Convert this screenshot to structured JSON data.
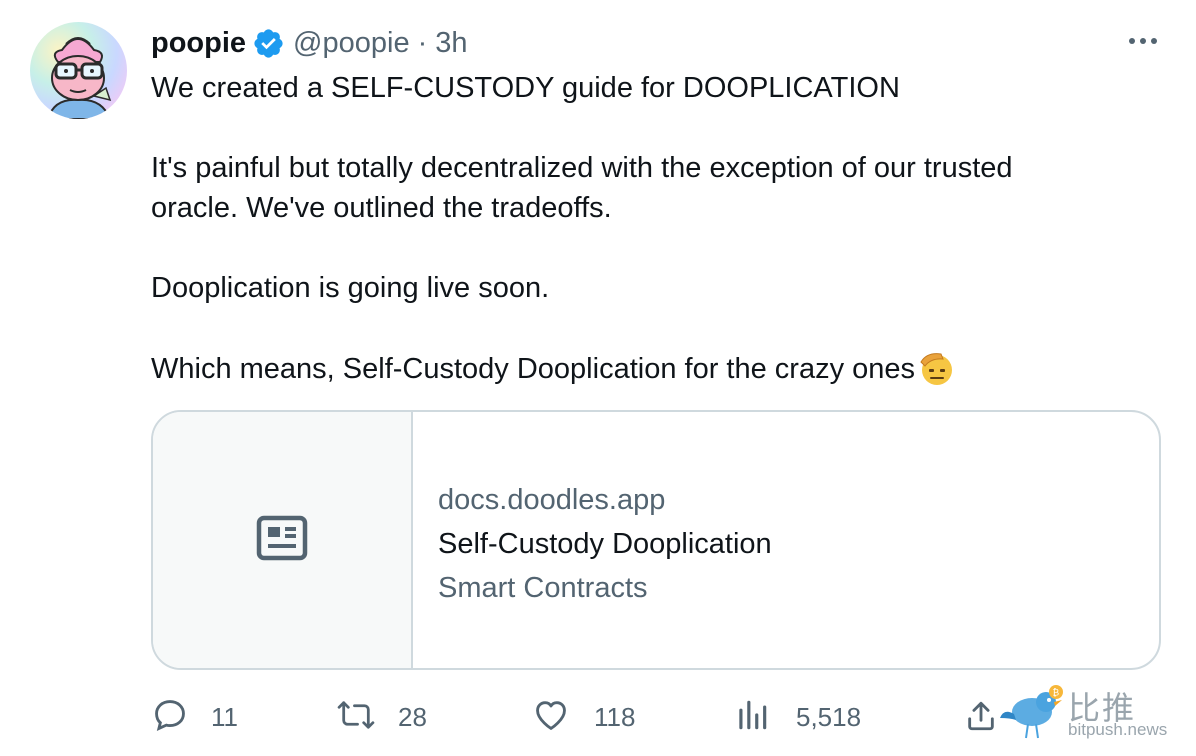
{
  "author": {
    "name": "poopie",
    "handle": "@poopie",
    "separator": "·",
    "time": "3h"
  },
  "tweet": {
    "lines": [
      "We created a SELF-CUSTODY guide for DOOPLICATION",
      "",
      "It's painful but totally decentralized with the exception of our trusted",
      "oracle. We've outlined the tradeoffs.",
      "",
      "Dooplication is going live soon.",
      "",
      "Which means, Self-Custody Dooplication for the crazy ones"
    ],
    "trailing_emoji": "saluting-face-emoji"
  },
  "card": {
    "domain": "docs.doodles.app",
    "title": "Self-Custody Dooplication",
    "description": "Smart Contracts",
    "thumb_icon": "article-icon"
  },
  "actions": {
    "replies": "11",
    "retweets": "28",
    "likes": "118",
    "views": "5,518"
  },
  "watermark": {
    "chinese": "比推",
    "domain": "bitpush.news"
  },
  "colors": {
    "text": "#0f1419",
    "secondary": "#536471",
    "verified": "#1d9bf0",
    "border": "#cfd9de"
  }
}
